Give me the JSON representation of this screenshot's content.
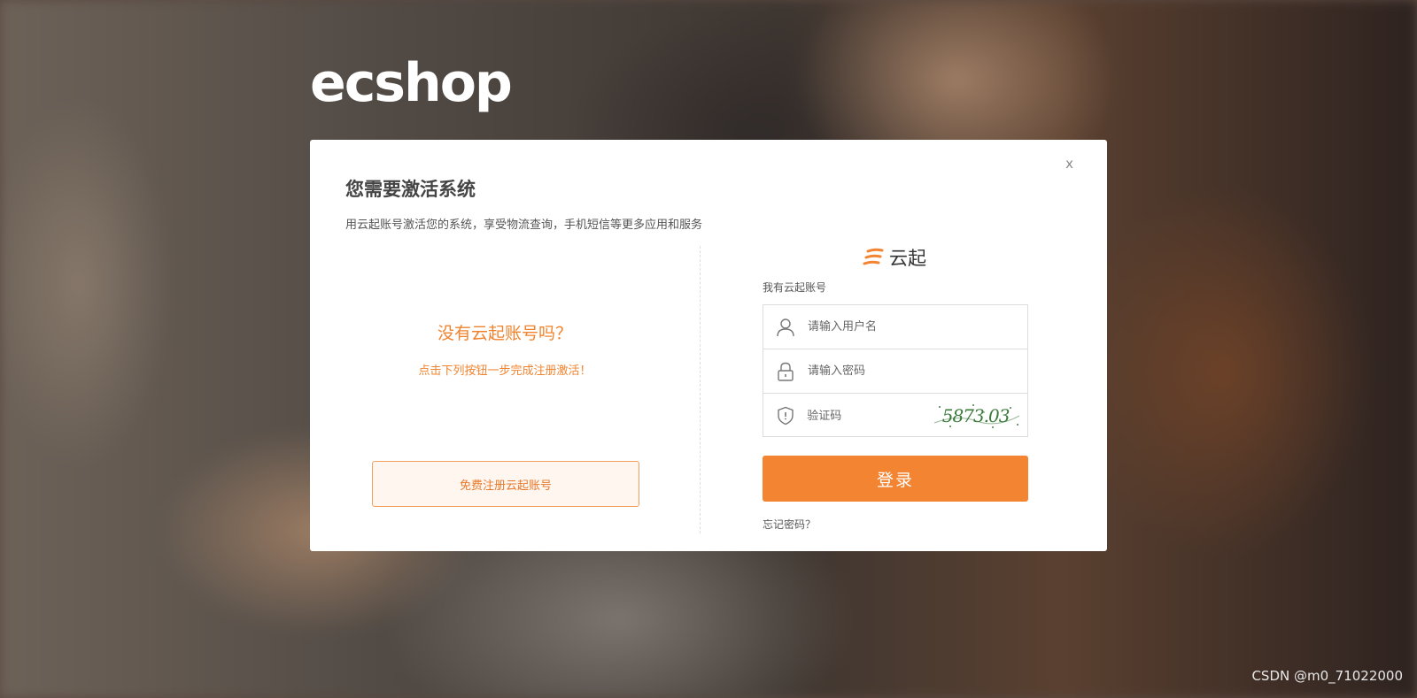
{
  "logo": {
    "text": "ecshop"
  },
  "dialog": {
    "close_label": "x",
    "title": "您需要激活系统",
    "subtitle": "用云起账号激活您的系统，享受物流查询，手机短信等更多应用和服务",
    "left": {
      "heading": "没有云起账号吗？",
      "subheading": "点击下列按钮一步完成注册激活！",
      "register_button": "免费注册云起账号"
    },
    "right": {
      "brand_text": "云起",
      "account_label": "我有云起账号",
      "username_placeholder": "请输入用户名",
      "password_placeholder": "请输入密码",
      "captcha_placeholder": "验证码",
      "captcha_text": "5873.03",
      "login_button": "登录",
      "forgot_link": "忘记密码？"
    }
  },
  "watermark": "CSDN @m0_71022000",
  "colors": {
    "accent": "#f28432",
    "heading_orange": "#f0832e"
  }
}
